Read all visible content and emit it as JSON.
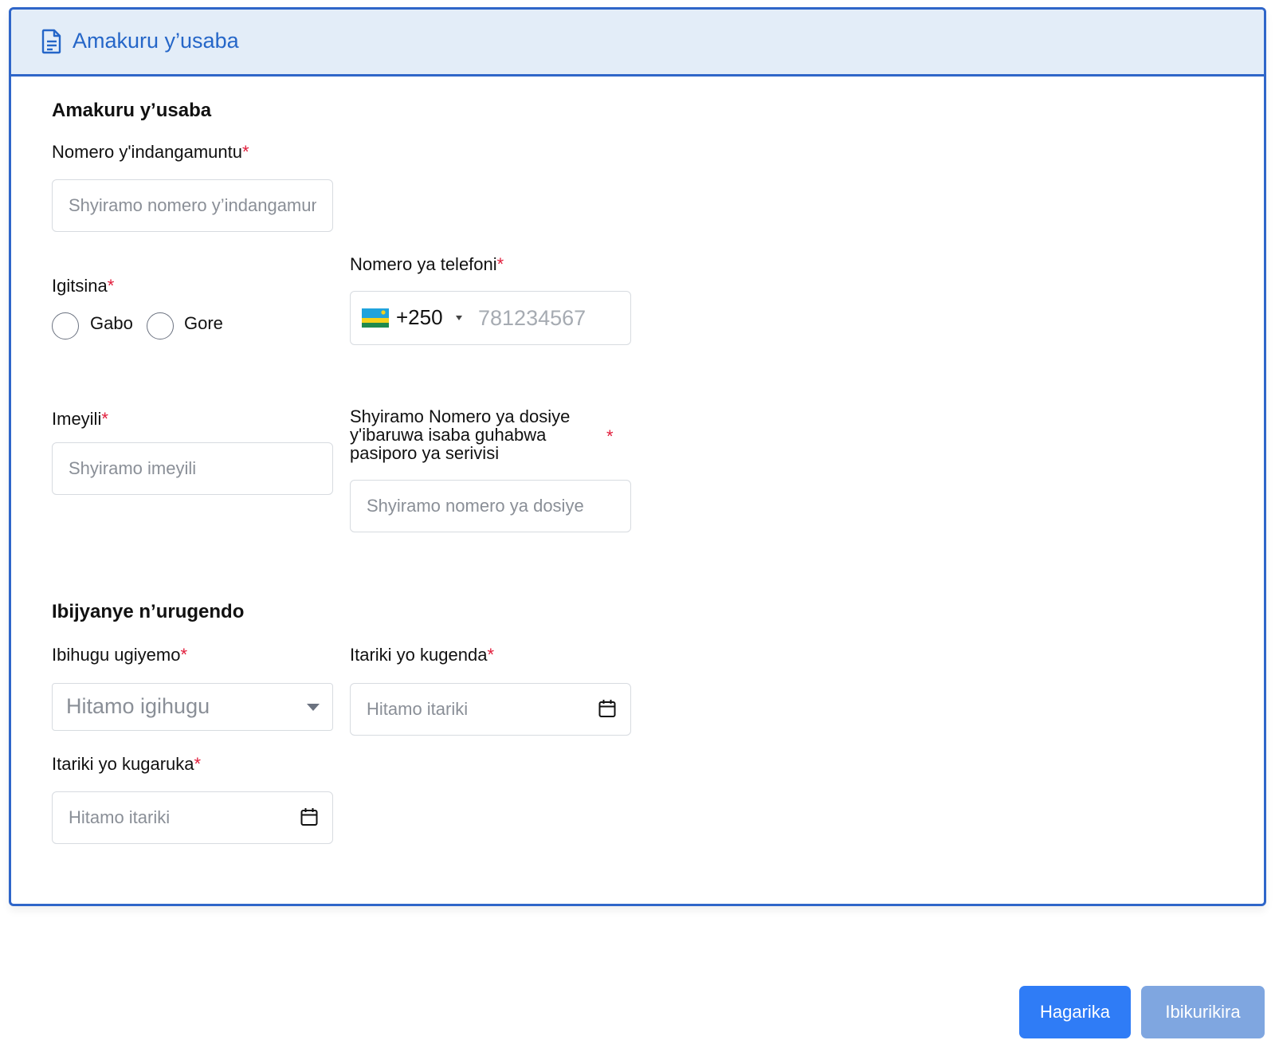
{
  "header": {
    "title": "Amakuru y’usaba",
    "icon": "document-icon"
  },
  "applicant_section": {
    "title": "Amakuru y’usaba",
    "id_number": {
      "label": "Nomero y'indangamuntu",
      "required_mark": "*",
      "placeholder": "Shyiramo nomero y’indangamuntu"
    },
    "gender": {
      "label": "Igitsina",
      "required_mark": "*",
      "options": [
        "Gabo",
        "Gore"
      ],
      "selected": null
    },
    "phone": {
      "label": "Nomero ya telefoni",
      "required_mark": "*",
      "dial_code": "+250",
      "country": "Rwanda",
      "placeholder": "781234567"
    },
    "email": {
      "label": "Imeyili",
      "required_mark": "*",
      "placeholder": "Shyiramo imeyili"
    },
    "file_number": {
      "label_lines": [
        "Shyiramo Nomero ya dosiye",
        "y'ibaruwa isaba guhabwa",
        "pasiporo ya serivisi"
      ],
      "required_mark": "*",
      "placeholder": "Shyiramo nomero ya dosiye"
    }
  },
  "travel_section": {
    "title": "Ibijyanye n’urugendo",
    "countries": {
      "label": "Ibihugu ugiyemo",
      "required_mark": "*",
      "placeholder": "Hitamo igihugu"
    },
    "departure_date": {
      "label": "Itariki yo kugenda",
      "required_mark": "*",
      "placeholder": "Hitamo itariki"
    },
    "return_date": {
      "label": "Itariki yo kugaruka",
      "required_mark": "*",
      "placeholder": "Hitamo itariki"
    }
  },
  "actions": {
    "cancel_label": "Hagarika",
    "next_label": "Ibikurikira"
  },
  "colors": {
    "accent": "#2f66c9",
    "header_bg": "#e3edf8",
    "required": "#e11d3b",
    "primary_button": "#2f7cf6",
    "disabled_button": "#7fa6e0"
  }
}
